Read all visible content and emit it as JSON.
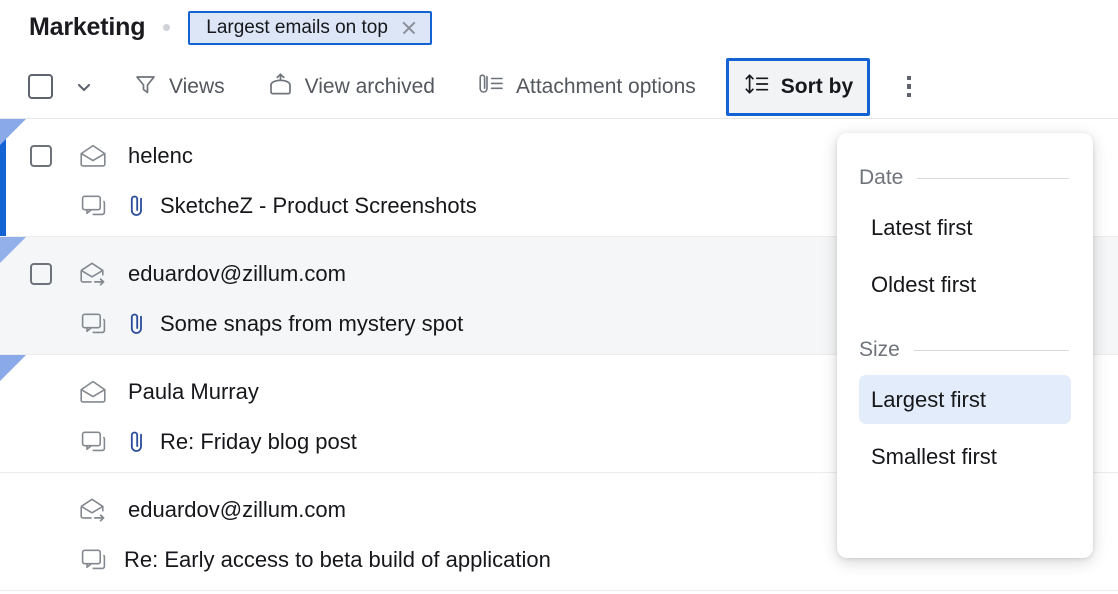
{
  "header": {
    "folder_title": "Marketing",
    "separator_dot": "dot",
    "filter_chip": {
      "label": "Largest emails on top",
      "close_icon": "close-icon",
      "border_color": "#1463d4",
      "fill_color": "#dce6f6"
    }
  },
  "toolbar": {
    "select_all_checkbox": "checkbox",
    "select_all_chevron": "chevron-down-icon",
    "items": [
      {
        "label": "Views",
        "icon": "filter-funnel-icon",
        "active": false
      },
      {
        "label": "View archived",
        "icon": "archive-up-icon",
        "active": false
      },
      {
        "label": "Attachment options",
        "icon": "attachment-list-icon",
        "active": false
      },
      {
        "label": "Sort by",
        "icon": "sort-arrows-icon",
        "active": true
      }
    ],
    "overflow_menu": "kebab-menu-icon"
  },
  "emails": [
    {
      "sender": "helenc",
      "subject": "SketcheZ - Product Screenshots",
      "envelope_icon": "envelope-open-icon",
      "thread_icon": "conversation-icon",
      "has_attachment": true,
      "checkbox_visible": true,
      "unread_bar": true,
      "hovered": false,
      "flag": true
    },
    {
      "sender": "eduardov@zillum.com",
      "subject": "Some snaps from mystery spot",
      "envelope_icon": "envelope-forward-icon",
      "thread_icon": "conversation-icon",
      "has_attachment": true,
      "checkbox_visible": true,
      "unread_bar": false,
      "hovered": true,
      "flag": true
    },
    {
      "sender": "Paula Murray",
      "subject": "Re: Friday blog post",
      "envelope_icon": "envelope-open-icon",
      "thread_icon": "conversation-icon",
      "has_attachment": true,
      "checkbox_visible": false,
      "unread_bar": false,
      "hovered": false,
      "flag": true
    },
    {
      "sender": "eduardov@zillum.com",
      "subject": "Re: Early access to beta build of application",
      "envelope_icon": "envelope-forward-icon",
      "thread_icon": "conversation-icon",
      "has_attachment": false,
      "checkbox_visible": false,
      "unread_bar": false,
      "hovered": false,
      "flag": false
    }
  ],
  "sort_dropdown": {
    "sections": [
      {
        "title": "Date",
        "items": [
          {
            "label": "Latest first",
            "selected": false
          },
          {
            "label": "Oldest first",
            "selected": false
          }
        ]
      },
      {
        "title": "Size",
        "items": [
          {
            "label": "Largest first",
            "selected": true
          },
          {
            "label": "Smallest first",
            "selected": false
          }
        ]
      }
    ],
    "highlight_color": "#e3ecfa"
  }
}
